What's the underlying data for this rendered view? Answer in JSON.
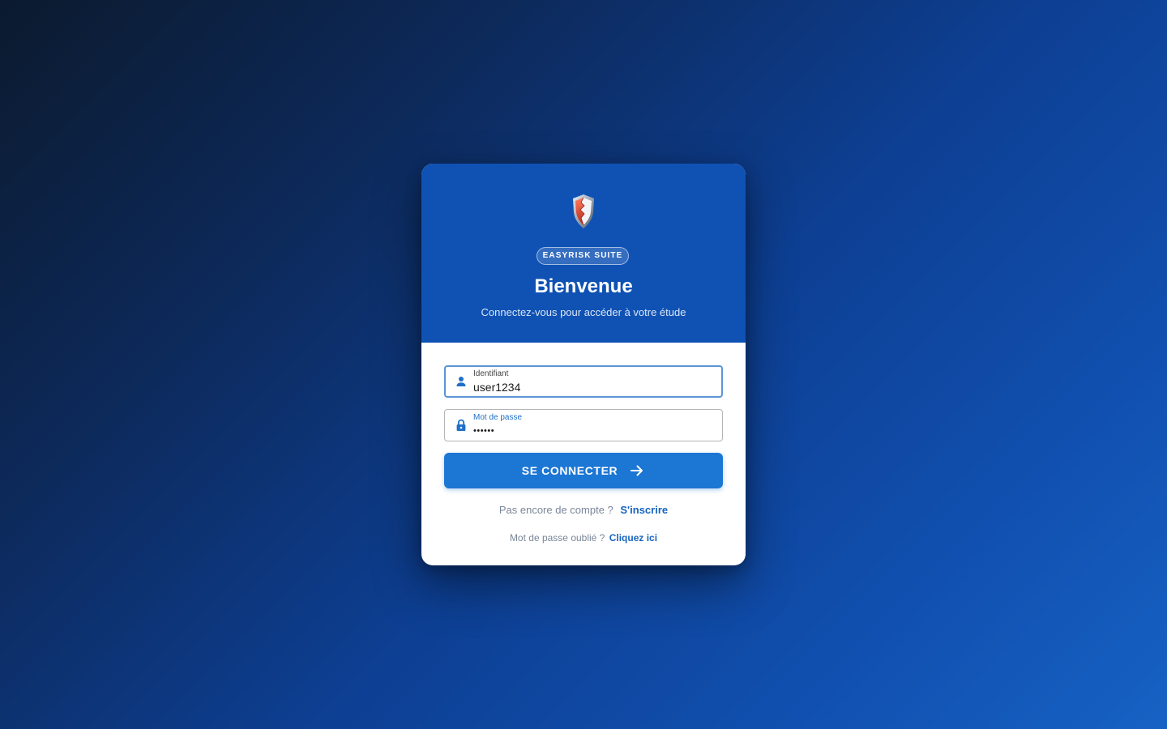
{
  "brand": {
    "logo_icon": "shield-icon",
    "badge": "EASYRISK SUITE"
  },
  "header": {
    "title": "Bienvenue",
    "subtitle": "Connectez-vous pour accéder à votre étude"
  },
  "form": {
    "username": {
      "icon": "user-icon",
      "label": "Identifiant",
      "value": "user1234"
    },
    "password": {
      "icon": "lock-icon",
      "label": "Mot de passe",
      "value": "••••••"
    },
    "submit": {
      "label": "SE CONNECTER",
      "icon": "arrow-right-icon"
    }
  },
  "links": {
    "signup_prompt": "Pas encore de compte ?",
    "signup_link": "S'inscrire",
    "forgot_prompt": "Mot de passe oublié ?",
    "forgot_link": "Cliquez ici"
  },
  "colors": {
    "header_bg": "#0f52b4",
    "accent": "#1c76d4",
    "link": "#1764c0",
    "logo_red": "#d9452f"
  }
}
